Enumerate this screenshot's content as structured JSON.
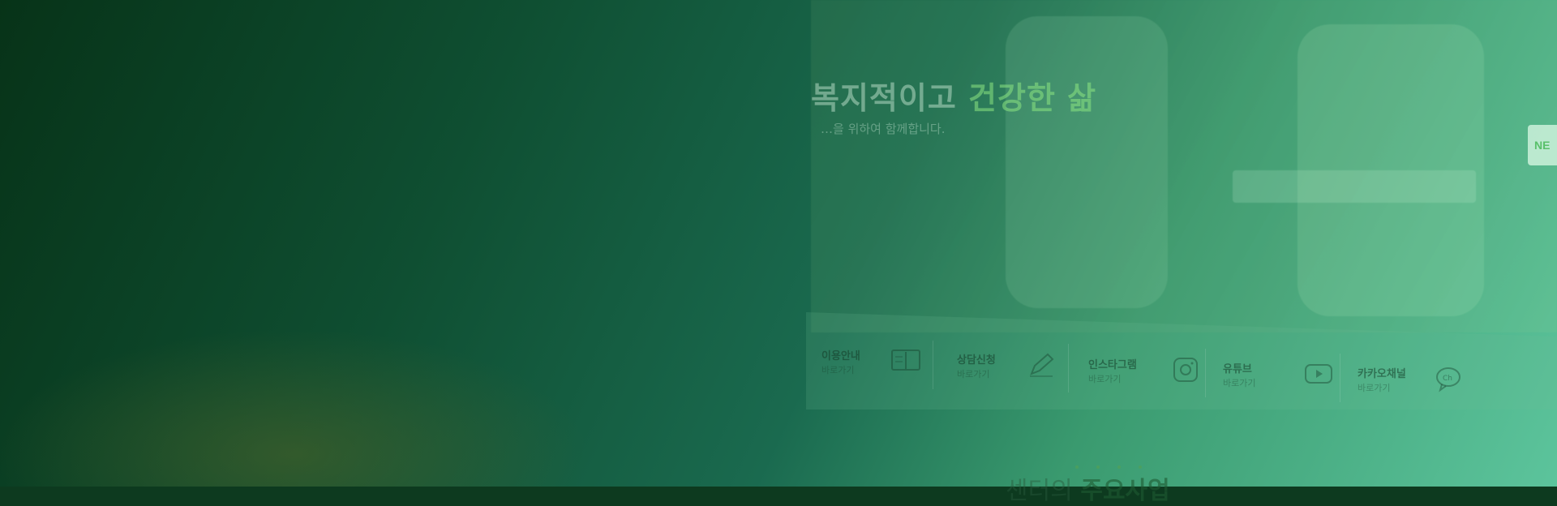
{
  "hero": {
    "headline_part1": "복지적이고",
    "headline_accent": "건강한 삶",
    "subline": "…을 위하여 함께합니다.",
    "side_button_label": "NE"
  },
  "quick_links": [
    {
      "title": "이용안내",
      "sub": "바로가기",
      "icon": "book-icon"
    },
    {
      "title": "상담신청",
      "sub": "바로가기",
      "icon": "pencil-icon"
    },
    {
      "title": "인스타그램",
      "sub": "바로가기",
      "icon": "instagram-icon"
    },
    {
      "title": "유튜브",
      "sub": "바로가기",
      "icon": "youtube-icon"
    },
    {
      "title": "카카오채널",
      "sub": "바로가기",
      "icon": "kakao-chat-icon"
    }
  ],
  "section": {
    "title_light": "센터의",
    "title_bold": "주요사업"
  },
  "colors": {
    "gradient_start": "#073318",
    "gradient_end": "#5cc49c",
    "accent": "#59c06a"
  }
}
